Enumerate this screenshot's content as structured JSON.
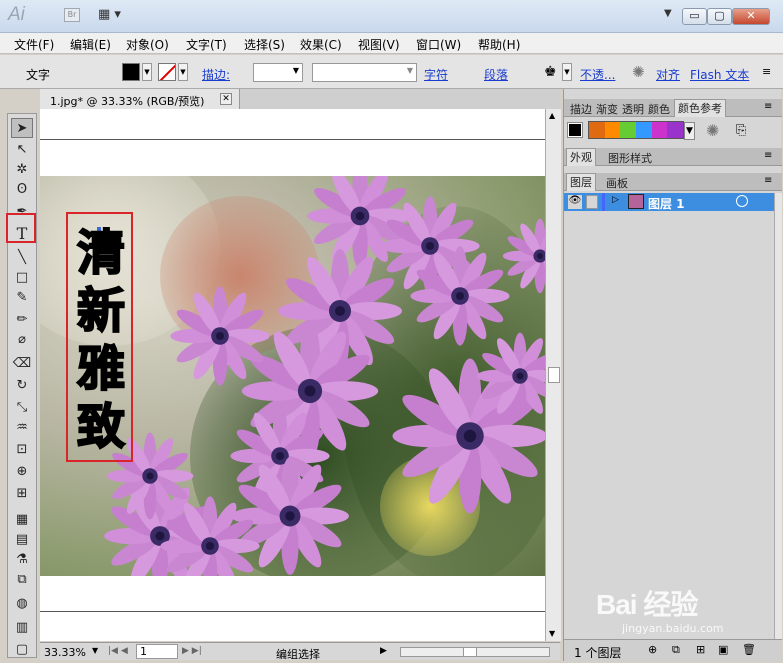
{
  "app": {
    "logo": "Ai",
    "br_label": "Br"
  },
  "window_buttons": [
    "▭",
    "▢",
    "✕"
  ],
  "menu": [
    "文件(F)",
    "编辑(E)",
    "对象(O)",
    "文字(T)",
    "选择(S)",
    "效果(C)",
    "视图(V)",
    "窗口(W)",
    "帮助(H)"
  ],
  "control_bar": {
    "tool_label": "文字",
    "stroke_label": "描边:",
    "char_link": "字符",
    "para_link": "段落",
    "opacity_link": "不透...",
    "align_link": "对齐",
    "flash_text_link": "Flash 文本"
  },
  "document": {
    "tab_title": "1.jpg* @ 33.33% (RGB/预览)",
    "tab_close": "✕",
    "vertical_text": [
      "清",
      "新",
      "雅",
      "致"
    ]
  },
  "status": {
    "zoom": "33.33%",
    "page": "1",
    "mode": "编组选择"
  },
  "panels": {
    "top_tabs": [
      "描边",
      "渐变",
      "透明",
      "颜色",
      "颜色参考"
    ],
    "mid_tabs": [
      "外观",
      "图形样式"
    ],
    "layer_tabs": [
      "图层",
      "画板"
    ],
    "layer_name": "图层 1",
    "layer_count": "1 个图层"
  },
  "colors": {
    "selection_red": "#d9252a",
    "layer_highlight": "#3d8ee0",
    "guide_swatches": [
      "#e06a10",
      "#ff8a00",
      "#66cc33",
      "#3399ff",
      "#cc33cc",
      "#9933cc"
    ]
  },
  "watermark": {
    "text": "Bai 经验",
    "sub": "jingyan.baidu.com"
  }
}
